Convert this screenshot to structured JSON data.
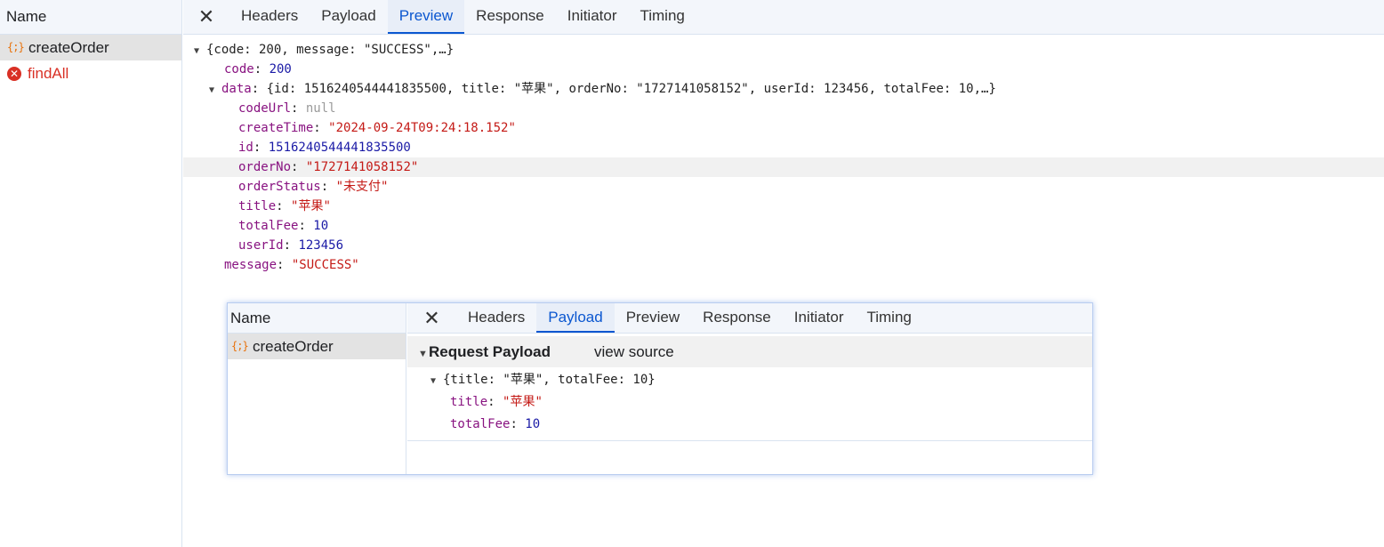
{
  "left_panel": {
    "header": "Name",
    "requests": [
      {
        "name": "createOrder",
        "icon": "fetch-icon",
        "selected": true
      },
      {
        "name": "findAll",
        "icon": "error-icon",
        "error": true
      }
    ]
  },
  "tabs": {
    "close": "✕",
    "items": [
      "Headers",
      "Payload",
      "Preview",
      "Response",
      "Initiator",
      "Timing"
    ],
    "active": "Preview"
  },
  "preview": {
    "root_summary": "{code: 200, message: \"SUCCESS\",…}",
    "code_key": "code",
    "code_value": "200",
    "data_key": "data",
    "data_summary": "{id: 1516240544441835500, title: \"苹果\", orderNo: \"1727141058152\", userId: 123456, totalFee: 10,…}",
    "fields": {
      "codeUrl": {
        "key": "codeUrl",
        "value": "null"
      },
      "createTime": {
        "key": "createTime",
        "value": "\"2024-09-24T09:24:18.152\""
      },
      "id": {
        "key": "id",
        "value": "1516240544441835500"
      },
      "orderNo": {
        "key": "orderNo",
        "value": "\"1727141058152\""
      },
      "orderStatus": {
        "key": "orderStatus",
        "value": "\"未支付\""
      },
      "title": {
        "key": "title",
        "value": "\"苹果\""
      },
      "totalFee": {
        "key": "totalFee",
        "value": "10"
      },
      "userId": {
        "key": "userId",
        "value": "123456"
      }
    },
    "message_key": "message",
    "message_value": "\"SUCCESS\""
  },
  "overlay": {
    "header": "Name",
    "request": "createOrder",
    "tabs": [
      "Headers",
      "Payload",
      "Preview",
      "Response",
      "Initiator",
      "Timing"
    ],
    "active_tab": "Payload",
    "payload_title": "Request Payload",
    "view_source": "view source",
    "summary": "{title: \"苹果\", totalFee: 10}",
    "title_key": "title",
    "title_value": "\"苹果\"",
    "fee_key": "totalFee",
    "fee_value": "10"
  },
  "colors": {
    "accent": "#0b57d0",
    "key": "#881280",
    "number": "#1a1aa6",
    "string": "#c41a16",
    "error": "#d93025"
  }
}
